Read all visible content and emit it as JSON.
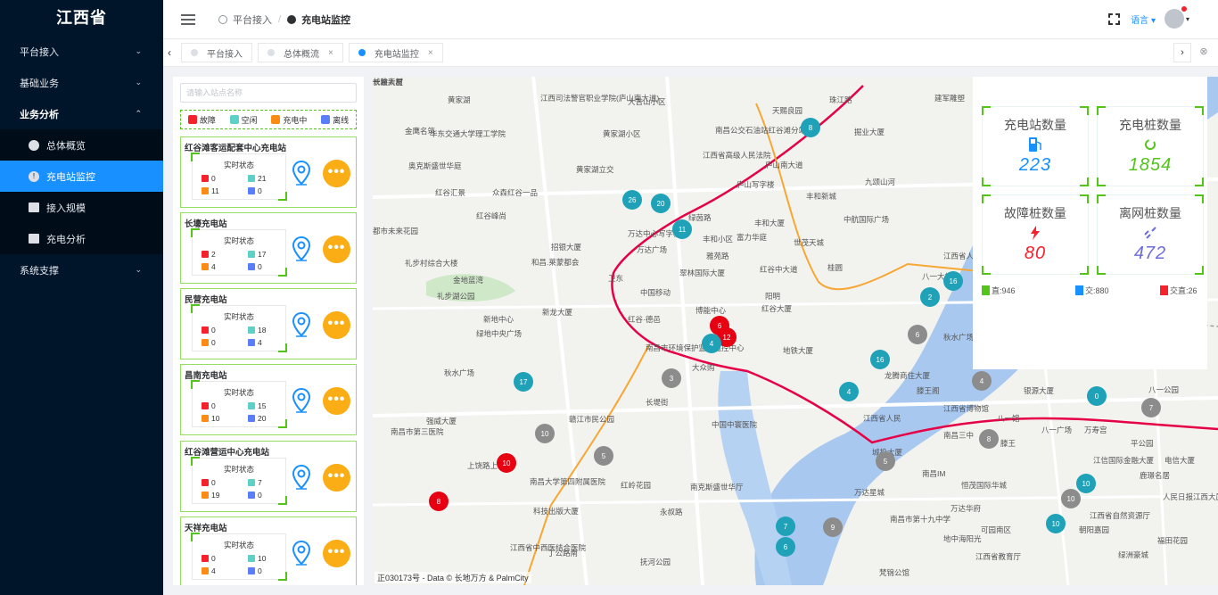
{
  "sidebar": {
    "brand": "江西省",
    "items": [
      {
        "label": "平台接入",
        "chev": "⌄"
      },
      {
        "label": "基础业务",
        "chev": "⌄"
      },
      {
        "label": "业务分析",
        "chev": "⌃"
      },
      {
        "label": "系统支撑",
        "chev": "⌄"
      }
    ],
    "sub": [
      {
        "label": "总体概览"
      },
      {
        "label": "充电站监控"
      },
      {
        "label": "接入规模"
      },
      {
        "label": "充电分析"
      }
    ]
  },
  "header": {
    "breadcrumb": [
      "平台接入",
      "充电站监控"
    ],
    "language": "语言 ▾"
  },
  "tabs": [
    {
      "label": "平台接入"
    },
    {
      "label": "总体概流"
    },
    {
      "label": "充电站监控"
    }
  ],
  "panel": {
    "search_placeholder": "请输入站点名称",
    "legend": [
      "故障",
      "空闲",
      "充电中",
      "离线"
    ],
    "status_label": "实时状态",
    "stations": [
      {
        "name": "红谷滩客运配套中心充电站",
        "fault": "0",
        "idle": "21",
        "charging": "11",
        "offline": "0"
      },
      {
        "name": "长壕充电站",
        "fault": "2",
        "idle": "17",
        "charging": "4",
        "offline": "0"
      },
      {
        "name": "民营充电站",
        "fault": "0",
        "idle": "18",
        "charging": "0",
        "offline": "4"
      },
      {
        "name": "昌南充电站",
        "fault": "0",
        "idle": "15",
        "charging": "10",
        "offline": "20"
      },
      {
        "name": "红谷滩营运中心充电站",
        "fault": "0",
        "idle": "7",
        "charging": "19",
        "offline": "0"
      },
      {
        "name": "天祥充电站",
        "fault": "0",
        "idle": "10",
        "charging": "4",
        "offline": "0"
      }
    ]
  },
  "stats": {
    "station_count_label": "充电站数量",
    "station_count": "223",
    "pile_count_label": "充电桩数量",
    "pile_count": "1854",
    "fault_label": "故障桩数量",
    "fault_count": "80",
    "offline_label": "离网桩数量",
    "offline_count": "472",
    "dc": "直:946",
    "ac": "交:880",
    "acdc": "交直:26",
    "colors": {
      "blue": "#1890ff",
      "green": "#52c41a",
      "red": "#f5222d",
      "purple": "#6c6cd9"
    }
  },
  "map": {
    "attribution": "正030173号 - Data © 长地万方 & PalmCity",
    "labels": [
      "黄家湖",
      "江西司法警官职业学院(庐山南大道)",
      "大吉山小区",
      "珠江路",
      "天赐良园",
      "建军雕塑",
      "金鹰名筑",
      "华东交通大学理工学院",
      "黄家湖小区",
      "南昌公交石油站红谷滩分站",
      "掘业大厦",
      "奥克斯盛世华庭",
      "江西省高级人民法院",
      "庐山南大道",
      "黄家湖立交",
      "九颂山河",
      "红谷汇景",
      "众森红谷一品",
      "庐山写字楼",
      "丰和新城",
      "红谷峰尚",
      "绿茵路",
      "中航国际广场",
      "都市未来花园",
      "丰和大厦",
      "万达中心写字楼",
      "丰和小区",
      "富力华庭",
      "世茂天城",
      "招银大厦",
      "万达广场",
      "雅苑路",
      "礼步村综合大楼",
      "和昌.莱蒙都会",
      "翠林国际大厦",
      "红谷中大道",
      "江西省人",
      "金地蓝湾",
      "礼步湖公园",
      "卫东",
      "中国移动",
      "桂圆",
      "八一大桥",
      "阳明",
      "新龙大厦",
      "博能中心",
      "红谷大厦",
      "新地中心",
      "红谷·德邑",
      "绿地中央广场",
      "南昌市环境保护监测监控中心",
      "地铁大厦",
      "秋水广场",
      "大众购",
      "秋水广场",
      "龙腾商住大厦",
      "滕王阁",
      "银源大厦",
      "八一公园",
      "江西省人民",
      "江西省博物馆",
      "南昌三中",
      "八一馆",
      "万寿宫",
      "八一广场",
      "强威大厦",
      "长堤街",
      "中国中寰医院",
      "赣江市民公园",
      "城投大厦",
      "滕王",
      "平公园",
      "江信国际金融大厦",
      "电信大厦",
      "鹿璟名居",
      "南昌IM",
      "恒茂国际华城",
      "人民日报江西大厦",
      "上饶路上",
      "南昌大学第四附属医院",
      "红岭花园",
      "南克斯盛世华厅",
      "万达星城",
      "万达华府",
      "江西省自然资源厅",
      "科技出版大厦",
      "永叔路",
      "南昌市第十九中学",
      "地中海阳光",
      "可园南区",
      "朝阳嘉园",
      "福田花园",
      "抚河公园",
      "江西省中西医结合医院",
      "丁公路南",
      "江西省教育厅",
      "绿洲豪城",
      "梵锦公馆",
      "南昌市第三医院",
      "一路大厦",
      "就业大厦",
      "长坡新村"
    ]
  }
}
